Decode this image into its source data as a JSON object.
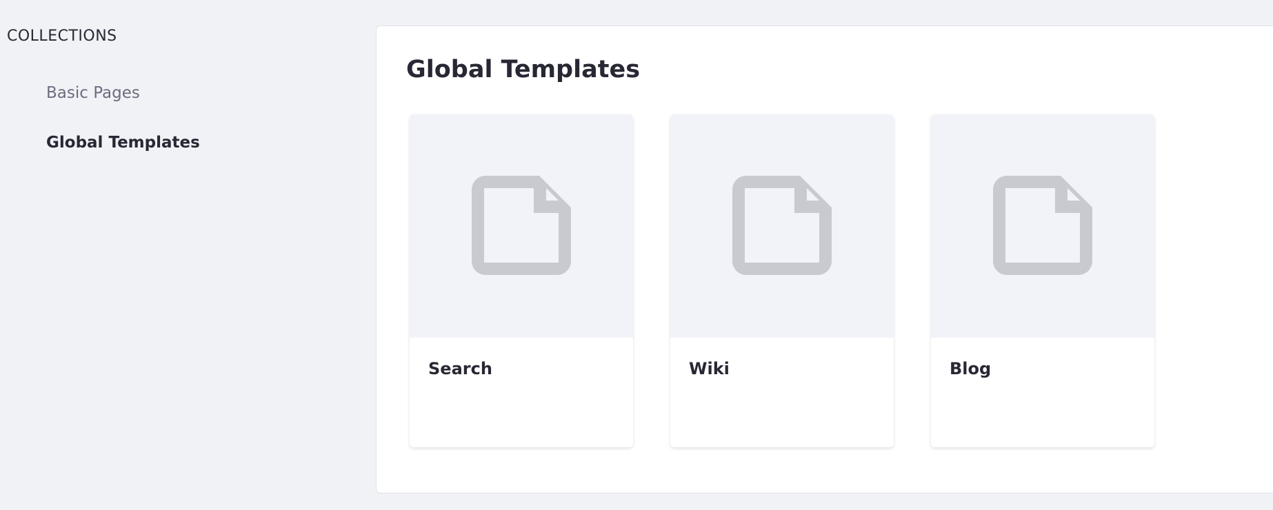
{
  "sidebar": {
    "heading": "COLLECTIONS",
    "items": [
      {
        "label": "Basic Pages",
        "active": false
      },
      {
        "label": "Global Templates",
        "active": true
      }
    ]
  },
  "main": {
    "title": "Global Templates",
    "cards": [
      {
        "label": "Search",
        "icon": "document-icon"
      },
      {
        "label": "Wiki",
        "icon": "document-icon"
      },
      {
        "label": "Blog",
        "icon": "document-icon"
      }
    ]
  },
  "colors": {
    "page_background": "#f1f2f6",
    "card_image_background": "#f1f3f8",
    "icon_color": "#c8cad0",
    "text_primary": "#272833",
    "text_secondary": "#6b6c7e"
  }
}
